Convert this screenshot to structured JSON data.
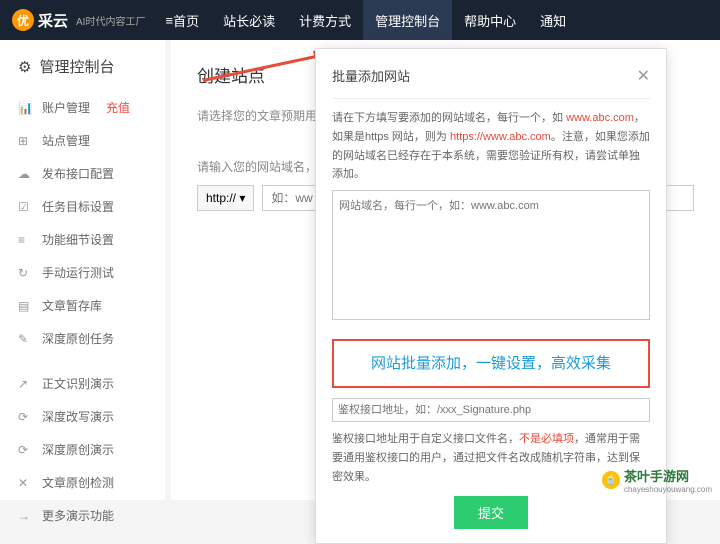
{
  "header": {
    "logo_badge": "优",
    "logo_text": "采云",
    "logo_sub": "AI时代内容工厂",
    "nav": [
      "首页",
      "站长必读",
      "计费方式",
      "管理控制台",
      "帮助中心",
      "通知"
    ]
  },
  "sidebar": {
    "title": "管理控制台",
    "items": [
      {
        "icon": "📊",
        "label": "账户管理",
        "extra": "充值"
      },
      {
        "icon": "⊞",
        "label": "站点管理"
      },
      {
        "icon": "☁",
        "label": "发布接口配置"
      },
      {
        "icon": "☑",
        "label": "任务目标设置"
      },
      {
        "icon": "≡",
        "label": "功能细节设置"
      },
      {
        "icon": "↻",
        "label": "手动运行测试"
      },
      {
        "icon": "▤",
        "label": "文章暂存库"
      },
      {
        "icon": "✎",
        "label": "深度原创任务"
      }
    ],
    "items2": [
      {
        "icon": "↗",
        "label": "正文识别演示"
      },
      {
        "icon": "⟳",
        "label": "深度改写演示"
      },
      {
        "icon": "⟳",
        "label": "深度原创演示"
      },
      {
        "icon": "✕",
        "label": "文章原创检测"
      },
      {
        "icon": "→",
        "label": "更多演示功能"
      }
    ]
  },
  "content": {
    "heading": "创建站点",
    "label1": "请选择您的文章预期用",
    "label2": "请输入您的网站域名，",
    "protocol": "http:// ▾",
    "domain_ph": "如：ww"
  },
  "modal": {
    "title": "批量添加网站",
    "desc1": "请在下方填写要添加的网站域名，每行一个，如 ",
    "ex1": "www.abc.com",
    "desc2": "，如果是https 网站，则为 ",
    "ex2": "https://www.abc.com",
    "desc3": "。注意，如果您添加的网站域名已经存在于本系统，需要您验证所有权，请尝试单独添加。",
    "ta_ph": "网站域名，每行一个，如：www.abc.com",
    "highlight": "网站批量添加，一键设置，高效采集",
    "auth_ph": "鉴权接口地址，如：/xxx_Signature.php",
    "auth_desc1": "鉴权接口地址用于自定义接口文件名，",
    "auth_red": "不是必填项",
    "auth_desc2": "，通常用于需要通用鉴权接口的用户，通过把文件名改成随机字符串，达到保密效果。",
    "submit": "提交"
  },
  "watermark": {
    "icon": "🍵",
    "text": "茶叶手游网",
    "sub": "chayeshouyouwang.com"
  }
}
